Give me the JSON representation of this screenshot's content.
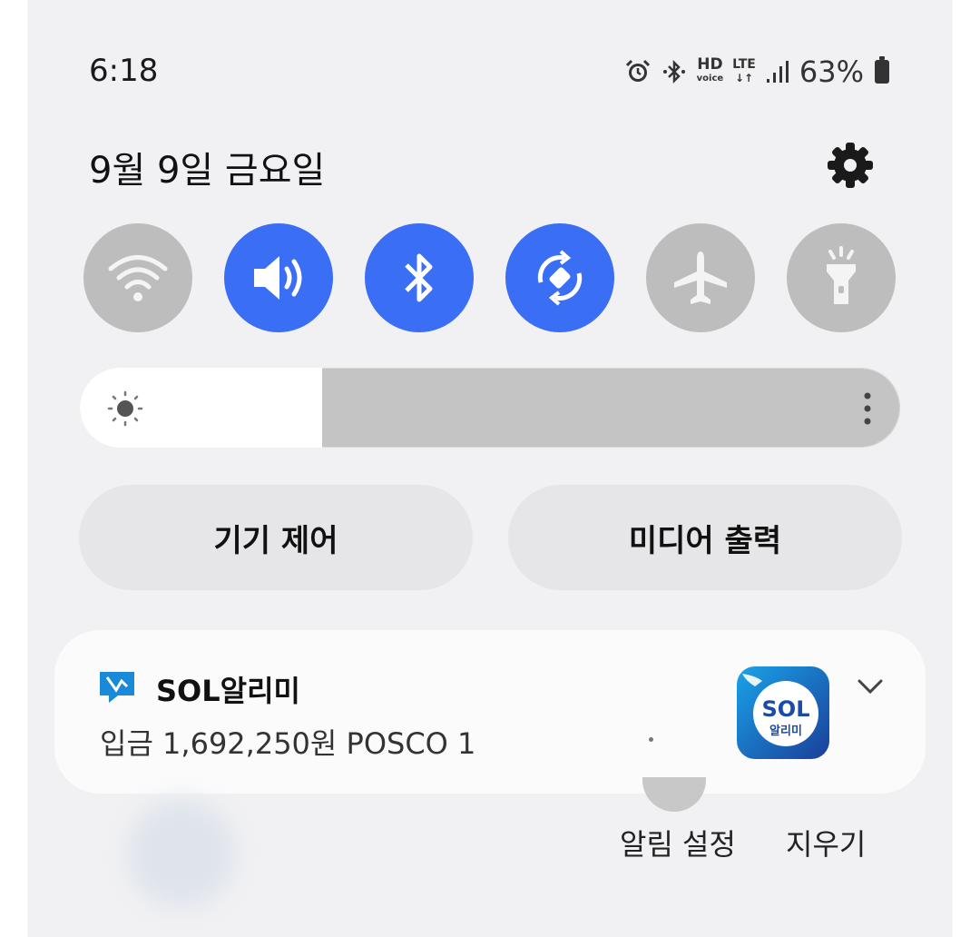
{
  "status_bar": {
    "time": "6:18",
    "hd_label": "HD",
    "voice_label": "voice",
    "lte_label": "LTE",
    "battery_percent": "63%"
  },
  "header": {
    "date": "9월 9일 금요일"
  },
  "quick_settings": [
    {
      "name": "wifi",
      "active": false
    },
    {
      "name": "sound",
      "active": true
    },
    {
      "name": "bluetooth",
      "active": true
    },
    {
      "name": "auto-rotate",
      "active": true
    },
    {
      "name": "airplane-mode",
      "active": false
    },
    {
      "name": "flashlight",
      "active": false
    }
  ],
  "brightness": {
    "level": 0.295
  },
  "buttons": {
    "device_control": "기기 제어",
    "media_output": "미디어 출력"
  },
  "notification": {
    "app_name": "SOL알리미",
    "text": "입금 1,692,250원 POSCO 1",
    "thumb_logo": "SOL",
    "thumb_sub": "알리미"
  },
  "actions": {
    "notification_settings": "알림 설정",
    "clear": "지우기"
  },
  "colors": {
    "active_tile": "#3a6ef5",
    "inactive_tile": "#bdbdbd"
  }
}
